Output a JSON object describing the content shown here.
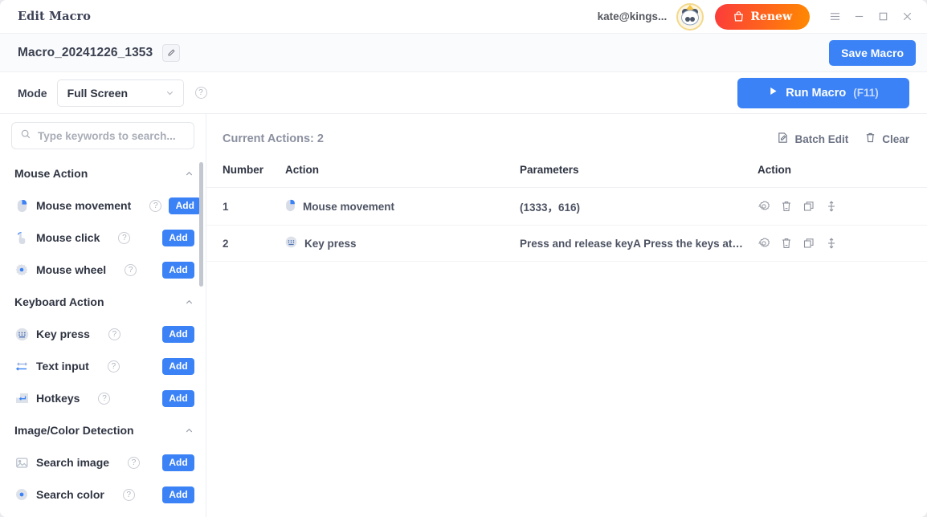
{
  "window": {
    "title": "Edit Macro",
    "account": "kate@kings...",
    "renew_label": "Renew",
    "avatar_name": "panda-avatar",
    "controls": {
      "menu": "menu-icon",
      "minimize": "minimize-icon",
      "maximize": "maximize-icon",
      "close": "close-icon"
    }
  },
  "namebar": {
    "macro_name": "Macro_20241226_1353",
    "edit_icon": "pencil-icon",
    "save_label": "Save Macro"
  },
  "modebar": {
    "mode_label": "Mode",
    "mode_value": "Full Screen",
    "mode_options": [
      "Full Screen"
    ],
    "help": "?",
    "run_label": "Run Macro",
    "run_hint": "(F11)"
  },
  "sidebar": {
    "search_placeholder": "Type keywords to search...",
    "search_value": "",
    "add_label": "Add",
    "sections": [
      {
        "title": "Mouse Action",
        "items": [
          {
            "label": "Mouse movement",
            "icon": "mouse-icon"
          },
          {
            "label": "Mouse click",
            "icon": "hand-click-icon"
          },
          {
            "label": "Mouse wheel",
            "icon": "mouse-wheel-icon"
          }
        ]
      },
      {
        "title": "Keyboard Action",
        "items": [
          {
            "label": "Key press",
            "icon": "keyboard-icon"
          },
          {
            "label": "Text input",
            "icon": "text-input-icon"
          },
          {
            "label": "Hotkeys",
            "icon": "enter-key-icon"
          }
        ]
      },
      {
        "title": "Image/Color Detection",
        "items": [
          {
            "label": "Search image",
            "icon": "image-icon"
          },
          {
            "label": "Search color",
            "icon": "color-icon"
          }
        ]
      }
    ]
  },
  "main": {
    "current_actions": "Current Actions: 2",
    "batch_edit_label": "Batch Edit",
    "clear_label": "Clear",
    "columns": [
      "Number",
      "Action",
      "Parameters",
      "Action"
    ],
    "rows": [
      {
        "number": "1",
        "action": "Mouse movement",
        "action_icon": "mouse-icon",
        "parameters": "(1333，616)"
      },
      {
        "number": "2",
        "action": "Key press",
        "action_icon": "keyboard-icon",
        "parameters": "Press and release keyA  Press the keys at…"
      }
    ],
    "row_ops": [
      "settings-icon",
      "delete-icon",
      "duplicate-icon",
      "move-icon"
    ]
  },
  "colors": {
    "accent_blue": "#3b82f6",
    "renew_orange": "#ff6a18",
    "text_dark": "#2f3442",
    "text_muted": "#8b90a0"
  }
}
